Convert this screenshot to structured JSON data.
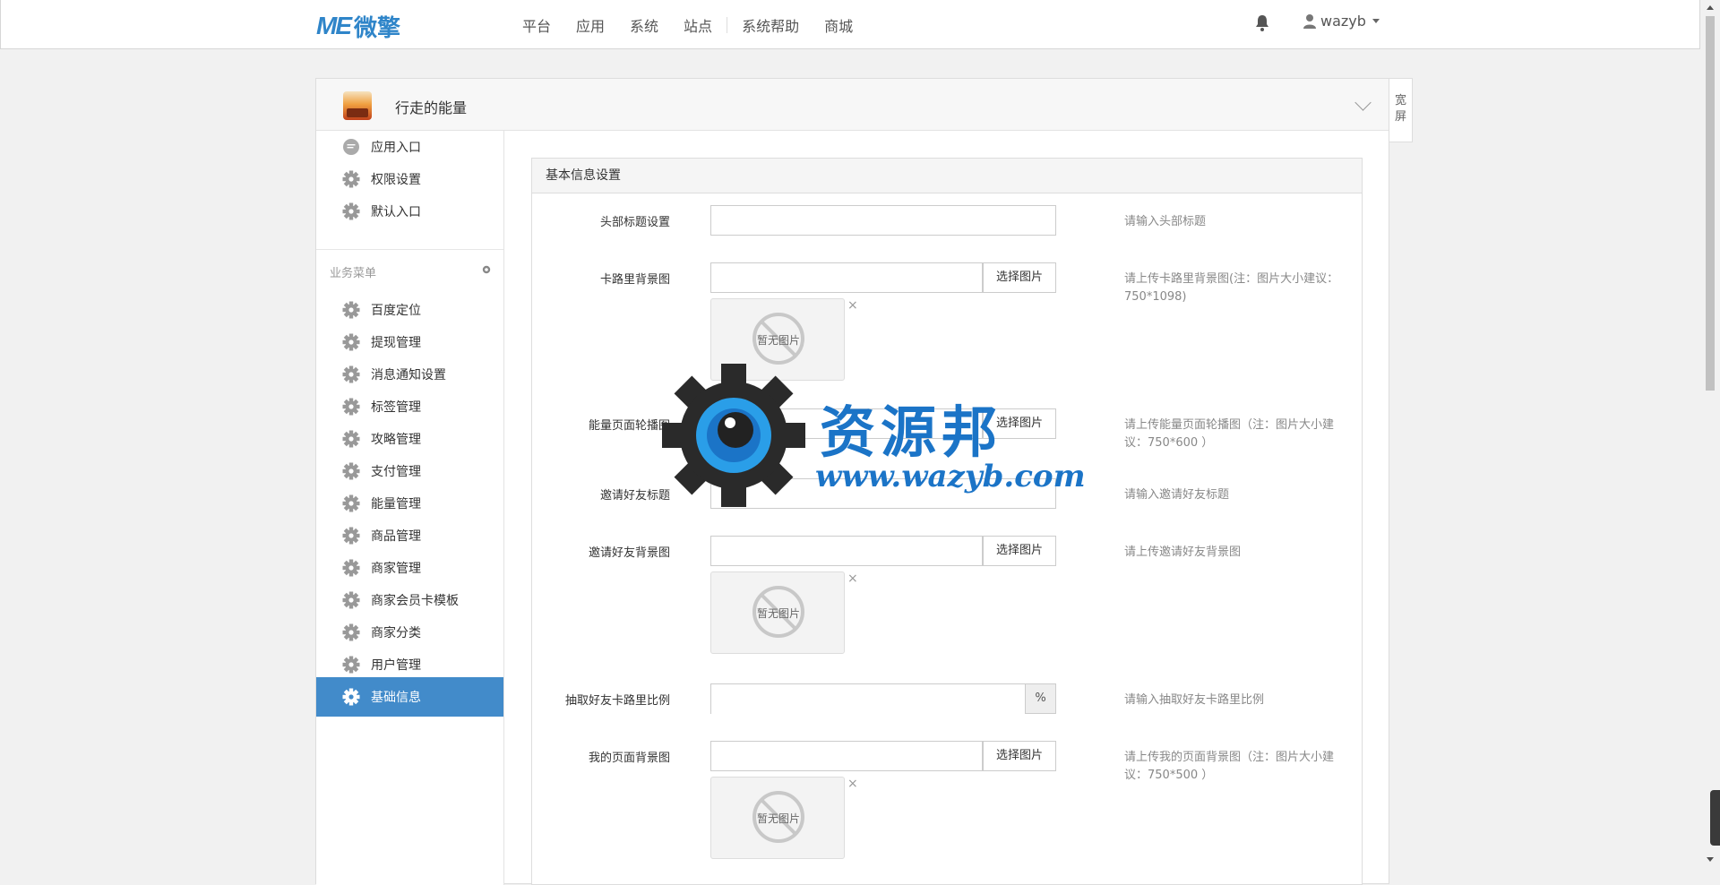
{
  "navbar": {
    "logo_me": "ME",
    "logo_cn": "微擎",
    "items": [
      "平台",
      "应用",
      "系统",
      "站点",
      "系统帮助",
      "商城"
    ],
    "username": "wazyb"
  },
  "panel": {
    "app_name": "行走的能量",
    "wide_label": "宽屏"
  },
  "sidebar": {
    "top_items": [
      {
        "label": "应用入口",
        "icon": "chat-icon"
      },
      {
        "label": "权限设置",
        "icon": "gear-icon"
      },
      {
        "label": "默认入口",
        "icon": "gear-icon"
      }
    ],
    "section_title": "业务菜单",
    "menu_items": [
      {
        "label": "百度定位"
      },
      {
        "label": "提现管理"
      },
      {
        "label": "消息通知设置"
      },
      {
        "label": "标签管理"
      },
      {
        "label": "攻略管理"
      },
      {
        "label": "支付管理"
      },
      {
        "label": "能量管理"
      },
      {
        "label": "商品管理"
      },
      {
        "label": "商家管理"
      },
      {
        "label": "商家会员卡模板"
      },
      {
        "label": "商家分类"
      },
      {
        "label": "用户管理"
      },
      {
        "label": "基础信息",
        "active": true
      }
    ],
    "active_color": "#428bca"
  },
  "form": {
    "title": "基本信息设置",
    "select_image_label": "选择图片",
    "no_image_label": "暂无图片",
    "delete_mark": "×",
    "percent_addon": "%",
    "fields": [
      {
        "label": "头部标题设置",
        "value": "",
        "help": "请输入头部标题"
      },
      {
        "label": "卡路里背景图",
        "value": "",
        "help": "请上传卡路里背景图(注：图片大小建议：750*1098)"
      },
      {
        "label": "能量页面轮播图",
        "value": "",
        "help": "请上传能量页面轮播图（注：图片大小建议：750*600 ）"
      },
      {
        "label": "邀请好友标题",
        "value": "",
        "help": "请输入邀请好友标题"
      },
      {
        "label": "邀请好友背景图",
        "value": "",
        "help": "请上传邀请好友背景图"
      },
      {
        "label": "抽取好友卡路里比例",
        "value": "",
        "help": "请输入抽取好友卡路里比例"
      },
      {
        "label": "我的页面背景图",
        "value": "",
        "help": "请上传我的页面背景图（注：图片大小建议：750*500 ）"
      }
    ]
  },
  "watermark": {
    "text_cn": "资源邦",
    "url": "www.wazyb.com"
  }
}
